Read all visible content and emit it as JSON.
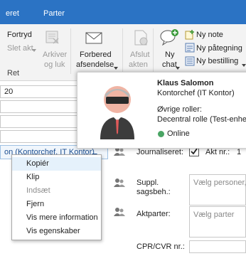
{
  "tabs": [
    "eret",
    "Parter"
  ],
  "ribbon": {
    "fortryd": "Fortryd",
    "slet_akt": "Slet akt",
    "arkiver_line1": "Arkiver",
    "arkiver_line2": "og luk",
    "forbered_line1": "Forbered",
    "forbered_line2": "afsendelse",
    "afslut_line1": "Afslut",
    "afslut_line2": "akten",
    "ny_chat_line1": "Ny",
    "ny_chat_line2": "chat",
    "ny_note": "Ny note",
    "ny_paategning": "Ny påtegning",
    "ny_bestilling": "Ny bestilling",
    "ret": "Ret"
  },
  "form": {
    "date_fragment": "20",
    "owner_value": "on (Kontorchef, IT Kontor)",
    "journaliseret_label": "Journaliseret:",
    "akt_nr_label": "Akt nr.:",
    "akt_nr_value": "1",
    "suppl_label_line1": "Suppl.",
    "suppl_label_line2": "sagsbeh.:",
    "suppl_placeholder": "Vælg personer, e",
    "aktparter_label": "Aktparter:",
    "aktparter_placeholder": "Vælg parter",
    "cpr_label": "CPR/CVR nr.:"
  },
  "contact_card": {
    "name": "Klaus Salomon",
    "title": "Kontorchef (IT Kontor)",
    "roles_label": "Øvrige roller:",
    "roles_value": "Decentral rolle (Test-enhede",
    "status": "Online",
    "status_color": "#4aa564"
  },
  "context_menu": {
    "items": [
      {
        "label": "Kopiér",
        "enabled": true
      },
      {
        "label": "Klip",
        "enabled": true
      },
      {
        "label": "Indsæt",
        "enabled": false
      },
      {
        "label": "Fjern",
        "enabled": true
      },
      {
        "label": "Vis mere information",
        "enabled": true
      },
      {
        "label": "Vis egenskaber",
        "enabled": true
      }
    ]
  },
  "icons": {
    "undo": "undo-icon",
    "archive": "archive-close-icon",
    "prepare_send": "envelope-send-icon",
    "finish": "finish-document-icon",
    "new_chat": "chat-add-icon",
    "new_note": "note-add-icon",
    "new_endorsement": "endorsement-icon",
    "new_order": "order-icon",
    "person_picker": "people-picker-icon",
    "avatar": "person-avatar-icon"
  },
  "colors": {
    "accent": "#2b73c4",
    "menu_highlight": "#e5f1fb"
  }
}
